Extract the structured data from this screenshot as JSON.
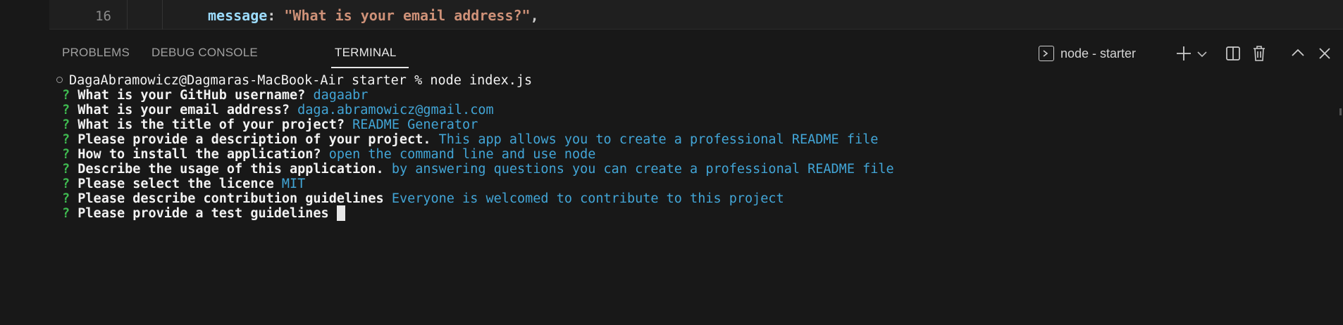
{
  "editor": {
    "line_number": "16",
    "code_key": "message",
    "code_colon": ": ",
    "code_string": "\"What is your email address?\"",
    "code_comma": ","
  },
  "panel": {
    "tabs": [
      {
        "label": "PROBLEMS"
      },
      {
        "label": "DEBUG CONSOLE"
      },
      {
        "label": "TERMINAL"
      }
    ],
    "active_tab": "TERMINAL",
    "terminal_name": "node - starter",
    "icons": [
      "terminal-icon",
      "plus-icon",
      "chevron-down-icon",
      "split-icon",
      "trash-icon",
      "chevron-up-icon",
      "close-icon"
    ]
  },
  "terminal": {
    "prompt_line": "DagaAbramowicz@Dagmaras-MacBook-Air starter % node index.js",
    "qa": [
      {
        "mark": "?",
        "question": "What is your GitHub username?",
        "answer": "dagaabr"
      },
      {
        "mark": "?",
        "question": "What is your email address?",
        "answer": "daga.abramowicz@gmail.com"
      },
      {
        "mark": "?",
        "question": "What is the title of your project?",
        "answer": "README Generator"
      },
      {
        "mark": "?",
        "question": "Please provide a description of your project.",
        "answer": "This app allows you to create a professional README file"
      },
      {
        "mark": "?",
        "question": "How to install the application?",
        "answer": "open the command line and use node"
      },
      {
        "mark": "?",
        "question": "Describe the usage of this application.",
        "answer": "by answering questions you can create a professional README file"
      },
      {
        "mark": "?",
        "question": "Please select the licence",
        "answer": "MIT"
      },
      {
        "mark": "?",
        "question": "Please describe contribution guidelines",
        "answer": "Everyone is welcomed to contribute to this project"
      },
      {
        "mark": "?",
        "question": "Please provide a test guidelines",
        "answer": ""
      }
    ]
  },
  "colors": {
    "question_mark": "#3fb950",
    "answer": "#42a5d6",
    "code_key": "#9cdcfe",
    "code_string": "#ce9178"
  }
}
